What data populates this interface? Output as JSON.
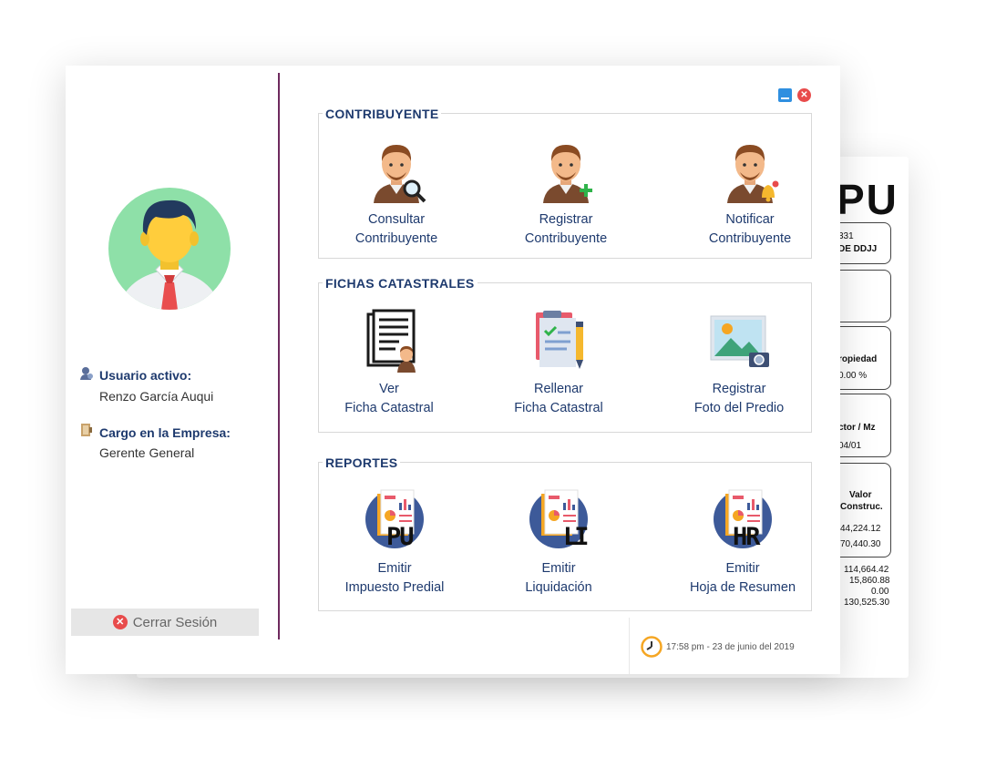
{
  "background_doc": {
    "heading": "PU",
    "fragments": [
      "331",
      "DE DDJJ",
      "ropiedad",
      "0.00 %",
      "ctor / Mz",
      "04/01",
      "Valor",
      "Construc.",
      "44,224.12",
      "70,440.30",
      "114,664.42",
      "15,860.88",
      "0.00",
      "130,525.30"
    ]
  },
  "sidebar": {
    "user_label": "Usuario activo:",
    "user_name": "Renzo García Auqui",
    "role_label": "Cargo en la Empresa:",
    "role_value": "Gerente General",
    "logout_label": "Cerrar Sesión"
  },
  "window_controls": {
    "minimize": "minimize-icon",
    "close": "close-icon"
  },
  "sections": {
    "contribuyente": {
      "title": "CONTRIBUYENTE",
      "items": [
        {
          "line1": "Consultar",
          "line2": "Contribuyente",
          "icon": "person-search-icon"
        },
        {
          "line1": "Registrar",
          "line2": "Contribuyente",
          "icon": "person-add-icon"
        },
        {
          "line1": "Notificar",
          "line2": "Contribuyente",
          "icon": "person-bell-icon"
        }
      ]
    },
    "fichas": {
      "title": "FICHAS CATASTRALES",
      "items": [
        {
          "line1": "Ver",
          "line2": "Ficha Catastral",
          "icon": "document-person-icon"
        },
        {
          "line1": "Rellenar",
          "line2": "Ficha Catastral",
          "icon": "clipboard-pen-icon"
        },
        {
          "line1": "Registrar",
          "line2": "Foto del Predio",
          "icon": "photo-camera-icon"
        }
      ]
    },
    "reportes": {
      "title": "REPORTES",
      "items": [
        {
          "line1": "Emitir",
          "line2": "Impuesto Predial",
          "badge": "PU",
          "icon": "report-icon"
        },
        {
          "line1": "Emitir",
          "line2": "Liquidación",
          "badge": "LI",
          "icon": "report-icon"
        },
        {
          "line1": "Emitir",
          "line2": "Hoja de Resumen",
          "badge": "HR",
          "icon": "report-icon"
        }
      ]
    }
  },
  "footer": {
    "datetime": "17:58 pm - 23 de junio del 2019",
    "icon": "clock-icon"
  },
  "colors": {
    "accent": "#1e3a6e",
    "divider": "#6e2a5e",
    "avatar_bg": "#8ee0a8",
    "close": "#e84b4b",
    "minimize": "#2f8fe0"
  }
}
